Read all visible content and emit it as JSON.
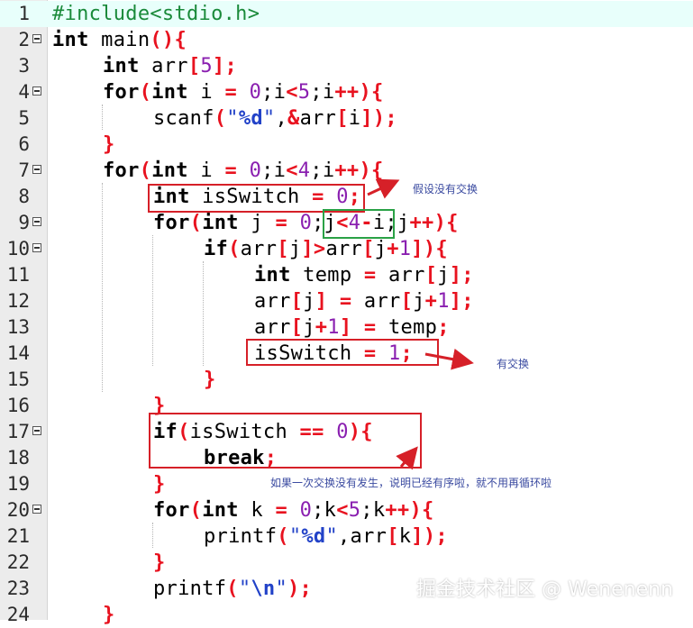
{
  "editor": {
    "current_line": 1,
    "lines": [
      {
        "n": "1",
        "fold": false,
        "indent": 0,
        "tokens": [
          [
            "pp",
            "#include<stdio.h>"
          ]
        ]
      },
      {
        "n": "2",
        "fold": true,
        "indent": 0,
        "tokens": [
          [
            "kw",
            "int"
          ],
          [
            "id",
            " main"
          ],
          [
            "op",
            "(){"
          ]
        ]
      },
      {
        "n": "3",
        "fold": false,
        "indent": 1,
        "tokens": [
          [
            "kw",
            "int"
          ],
          [
            "id",
            " arr"
          ],
          [
            "op",
            "["
          ],
          [
            "num",
            "5"
          ],
          [
            "op",
            "];"
          ]
        ]
      },
      {
        "n": "4",
        "fold": true,
        "indent": 1,
        "tokens": [
          [
            "kw",
            "for"
          ],
          [
            "op",
            "("
          ],
          [
            "kw",
            "int"
          ],
          [
            "id",
            " i "
          ],
          [
            "op",
            "="
          ],
          [
            "id",
            " "
          ],
          [
            "num",
            "0"
          ],
          [
            "id",
            ";i"
          ],
          [
            "op",
            "<"
          ],
          [
            "num",
            "5"
          ],
          [
            "id",
            ";i"
          ],
          [
            "op",
            "++){"
          ]
        ]
      },
      {
        "n": "5",
        "fold": false,
        "indent": 2,
        "tokens": [
          [
            "id",
            "scanf"
          ],
          [
            "op",
            "("
          ],
          [
            "str",
            "\""
          ],
          [
            "esc",
            "%d"
          ],
          [
            "str",
            "\""
          ],
          [
            "id",
            ","
          ],
          [
            "op",
            "&"
          ],
          [
            "id",
            "arr"
          ],
          [
            "op",
            "["
          ],
          [
            "id",
            "i"
          ],
          [
            "op",
            "]);"
          ]
        ]
      },
      {
        "n": "6",
        "fold": false,
        "indent": 1,
        "tokens": [
          [
            "op",
            "}"
          ]
        ]
      },
      {
        "n": "7",
        "fold": true,
        "indent": 1,
        "tokens": [
          [
            "kw",
            "for"
          ],
          [
            "op",
            "("
          ],
          [
            "kw",
            "int"
          ],
          [
            "id",
            " i "
          ],
          [
            "op",
            "="
          ],
          [
            "id",
            " "
          ],
          [
            "num",
            "0"
          ],
          [
            "id",
            ";i"
          ],
          [
            "op",
            "<"
          ],
          [
            "num",
            "4"
          ],
          [
            "id",
            ";i"
          ],
          [
            "op",
            "++){"
          ]
        ]
      },
      {
        "n": "8",
        "fold": false,
        "indent": 2,
        "tokens": [
          [
            "kw",
            "int"
          ],
          [
            "id",
            " isSwitch "
          ],
          [
            "op",
            "="
          ],
          [
            "id",
            " "
          ],
          [
            "num",
            "0"
          ],
          [
            "op",
            ";"
          ]
        ]
      },
      {
        "n": "9",
        "fold": true,
        "indent": 2,
        "tokens": [
          [
            "kw",
            "for"
          ],
          [
            "op",
            "("
          ],
          [
            "kw",
            "int"
          ],
          [
            "id",
            " j "
          ],
          [
            "op",
            "="
          ],
          [
            "id",
            " "
          ],
          [
            "num",
            "0"
          ],
          [
            "id",
            ";j"
          ],
          [
            "op",
            "<"
          ],
          [
            "num",
            "4"
          ],
          [
            "op",
            "-"
          ],
          [
            "id",
            "i;j"
          ],
          [
            "op",
            "++){"
          ]
        ]
      },
      {
        "n": "10",
        "fold": true,
        "indent": 3,
        "tokens": [
          [
            "kw",
            "if"
          ],
          [
            "op",
            "("
          ],
          [
            "id",
            "arr"
          ],
          [
            "op",
            "["
          ],
          [
            "id",
            "j"
          ],
          [
            "op",
            "]>"
          ],
          [
            "id",
            "arr"
          ],
          [
            "op",
            "["
          ],
          [
            "id",
            "j"
          ],
          [
            "op",
            "+"
          ],
          [
            "num",
            "1"
          ],
          [
            "op",
            "]){"
          ]
        ]
      },
      {
        "n": "11",
        "fold": false,
        "indent": 4,
        "tokens": [
          [
            "kw",
            "int"
          ],
          [
            "id",
            " temp "
          ],
          [
            "op",
            "="
          ],
          [
            "id",
            " arr"
          ],
          [
            "op",
            "["
          ],
          [
            "id",
            "j"
          ],
          [
            "op",
            "];"
          ]
        ]
      },
      {
        "n": "12",
        "fold": false,
        "indent": 4,
        "tokens": [
          [
            "id",
            "arr"
          ],
          [
            "op",
            "["
          ],
          [
            "id",
            "j"
          ],
          [
            "op",
            "]"
          ],
          [
            "id",
            " "
          ],
          [
            "op",
            "="
          ],
          [
            "id",
            " arr"
          ],
          [
            "op",
            "["
          ],
          [
            "id",
            "j"
          ],
          [
            "op",
            "+"
          ],
          [
            "num",
            "1"
          ],
          [
            "op",
            "];"
          ]
        ]
      },
      {
        "n": "13",
        "fold": false,
        "indent": 4,
        "tokens": [
          [
            "id",
            "arr"
          ],
          [
            "op",
            "["
          ],
          [
            "id",
            "j"
          ],
          [
            "op",
            "+"
          ],
          [
            "num",
            "1"
          ],
          [
            "op",
            "]"
          ],
          [
            "id",
            " "
          ],
          [
            "op",
            "="
          ],
          [
            "id",
            " temp"
          ],
          [
            "op",
            ";"
          ]
        ]
      },
      {
        "n": "14",
        "fold": false,
        "indent": 4,
        "tokens": [
          [
            "id",
            "isSwitch "
          ],
          [
            "op",
            "="
          ],
          [
            "id",
            " "
          ],
          [
            "num",
            "1"
          ],
          [
            "op",
            ";"
          ]
        ]
      },
      {
        "n": "15",
        "fold": false,
        "indent": 3,
        "tokens": [
          [
            "op",
            "}"
          ]
        ]
      },
      {
        "n": "16",
        "fold": false,
        "indent": 2,
        "tokens": [
          [
            "op",
            "}"
          ]
        ]
      },
      {
        "n": "17",
        "fold": true,
        "indent": 2,
        "tokens": [
          [
            "kw",
            "if"
          ],
          [
            "op",
            "("
          ],
          [
            "id",
            "isSwitch "
          ],
          [
            "op",
            "=="
          ],
          [
            "id",
            " "
          ],
          [
            "num",
            "0"
          ],
          [
            "op",
            "){"
          ]
        ]
      },
      {
        "n": "18",
        "fold": false,
        "indent": 3,
        "tokens": [
          [
            "kw",
            "break"
          ],
          [
            "op",
            ";"
          ]
        ]
      },
      {
        "n": "19",
        "fold": false,
        "indent": 2,
        "tokens": [
          [
            "op",
            "}"
          ]
        ]
      },
      {
        "n": "20",
        "fold": true,
        "indent": 2,
        "tokens": [
          [
            "kw",
            "for"
          ],
          [
            "op",
            "("
          ],
          [
            "kw",
            "int"
          ],
          [
            "id",
            " k "
          ],
          [
            "op",
            "="
          ],
          [
            "id",
            " "
          ],
          [
            "num",
            "0"
          ],
          [
            "id",
            ";k"
          ],
          [
            "op",
            "<"
          ],
          [
            "num",
            "5"
          ],
          [
            "id",
            ";k"
          ],
          [
            "op",
            "++){"
          ]
        ]
      },
      {
        "n": "21",
        "fold": false,
        "indent": 3,
        "tokens": [
          [
            "id",
            "printf"
          ],
          [
            "op",
            "("
          ],
          [
            "str",
            "\""
          ],
          [
            "esc",
            "%d"
          ],
          [
            "str",
            "\""
          ],
          [
            "id",
            ",arr"
          ],
          [
            "op",
            "["
          ],
          [
            "id",
            "k"
          ],
          [
            "op",
            "]);"
          ]
        ]
      },
      {
        "n": "22",
        "fold": false,
        "indent": 2,
        "tokens": [
          [
            "op",
            "}"
          ]
        ]
      },
      {
        "n": "23",
        "fold": false,
        "indent": 2,
        "tokens": [
          [
            "id",
            "printf"
          ],
          [
            "op",
            "("
          ],
          [
            "str",
            "\""
          ],
          [
            "esc",
            "\\n"
          ],
          [
            "str",
            "\""
          ],
          [
            "op",
            ");"
          ]
        ]
      },
      {
        "n": "24",
        "fold": false,
        "indent": 1,
        "tokens": [
          [
            "op",
            "}"
          ]
        ]
      }
    ]
  },
  "annotations": {
    "note_1": "假设没有交换",
    "note_2": "有交换",
    "note_3": "如果一次交换没有发生，说明已经有序啦，就不用再循环啦"
  },
  "watermark": "掘金技术社区 @ Wenenenn",
  "colors": {
    "keyword": "#000000",
    "operator": "#e8121f",
    "number": "#8a1fb0",
    "string": "#2242c8",
    "preprocessor": "#1a8a3a",
    "highlight_box": "#d62028",
    "condition_box": "#2aa146",
    "note_text": "#3a4aa0"
  }
}
